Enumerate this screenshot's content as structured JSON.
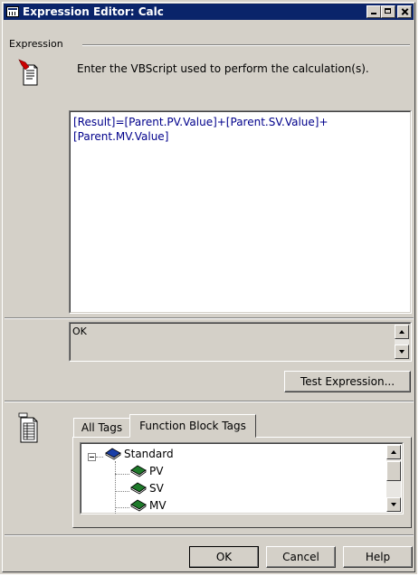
{
  "window": {
    "title": "Expression Editor: Calc"
  },
  "expression_group": {
    "label": "Expression",
    "instruction": "Enter the VBScript used to perform the calculation(s).",
    "expression_text": "[Result]=[Parent.PV.Value]+[Parent.SV.Value]+\n[Parent.MV.Value]",
    "result_text": "OK",
    "test_button_label": "Test Expression..."
  },
  "tags": {
    "tabs": [
      {
        "label": "All Tags",
        "active": false
      },
      {
        "label": "Function Block Tags",
        "active": true
      }
    ],
    "tree": {
      "root": "Standard",
      "children": [
        "PV",
        "SV",
        "MV"
      ]
    }
  },
  "footer": {
    "ok_label": "OK",
    "cancel_label": "Cancel",
    "help_label": "Help"
  },
  "colors": {
    "titlebar": "#0a246a",
    "expression_text": "#00008b",
    "face": "#d4d0c8",
    "book_blue": "#1a3fa8",
    "book_green": "#1e7a2a"
  },
  "icons": [
    "calculator-icon",
    "minimize-icon",
    "maximize-icon",
    "close-icon",
    "document-icon",
    "tags-document-icon",
    "book-icon"
  ]
}
